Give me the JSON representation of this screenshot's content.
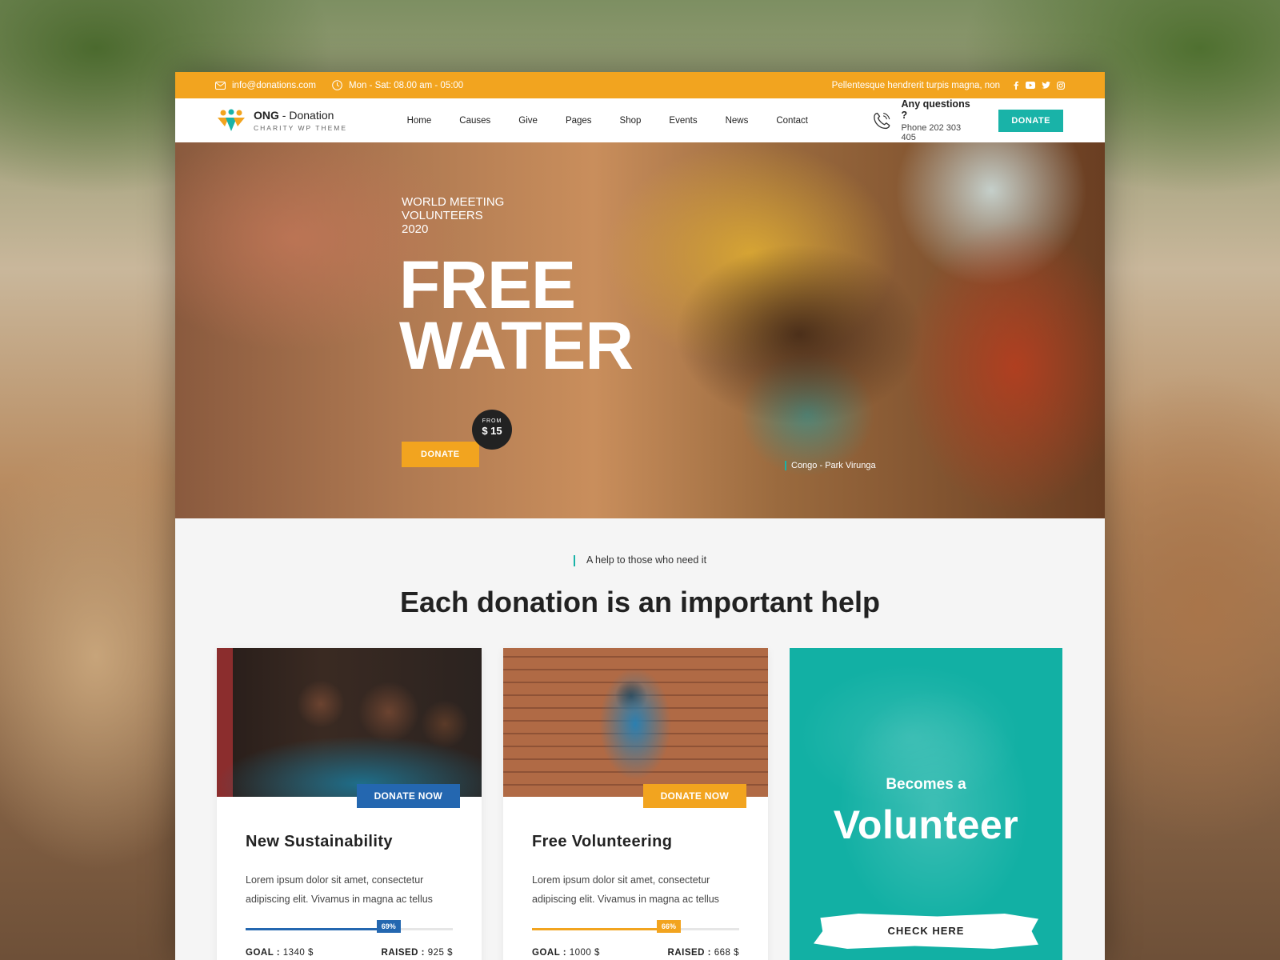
{
  "topbar": {
    "email": "info@donations.com",
    "hours": "Mon - Sat: 08.00 am - 05:00",
    "tagline": "Pellentesque hendrerit turpis magna, non",
    "social_icons": [
      "facebook-icon",
      "youtube-icon",
      "twitter-icon",
      "instagram-icon"
    ]
  },
  "header": {
    "logo_brand": "ONG",
    "logo_dash": " - ",
    "logo_name": "Donation",
    "logo_sub": "CHARITY WP THEME",
    "nav": [
      "Home",
      "Causes",
      "Give",
      "Pages",
      "Shop",
      "Events",
      "News",
      "Contact"
    ],
    "contact_question": "Any questions ?",
    "contact_phone": "Phone 202 303 405",
    "donate_label": "DONATE"
  },
  "hero": {
    "pre_line1": "WORLD MEETING",
    "pre_line2": "VOLUNTEERS",
    "pre_line3": "2020",
    "title_line1": "FREE",
    "title_line2": "WATER",
    "donate_label": "DONATE",
    "from_label": "FROM",
    "from_price": "$ 15",
    "location": "Congo - Park Virunga"
  },
  "section": {
    "subtitle": "A help to those who need it",
    "title": "Each donation is an important help"
  },
  "cards": [
    {
      "donate_label": "DONATE NOW",
      "title": "New Sustainability",
      "text": "Lorem ipsum dolor sit amet, consectetur adipiscing elit. Vivamus in magna ac tellus",
      "progress": 69,
      "progress_label": "69%",
      "goal_label": "GOAL :",
      "goal_value": "1340 $",
      "raised_label": "RAISED :",
      "raised_value": "925 $",
      "color": "#2467b0"
    },
    {
      "donate_label": "DONATE NOW",
      "title": "Free Volunteering",
      "text": "Lorem ipsum dolor sit amet, consectetur adipiscing elit. Vivamus in magna ac tellus",
      "progress": 66,
      "progress_label": "66%",
      "goal_label": "GOAL :",
      "goal_value": "1000 $",
      "raised_label": "RAISED :",
      "raised_value": "668 $",
      "color": "#f2a41f"
    }
  ],
  "volunteer": {
    "line1": "Becomes a",
    "line2": "Volunteer",
    "cta": "CHECK HERE"
  },
  "colors": {
    "accent_orange": "#f2a41f",
    "accent_teal": "#19b3a8",
    "accent_blue": "#2467b0"
  }
}
